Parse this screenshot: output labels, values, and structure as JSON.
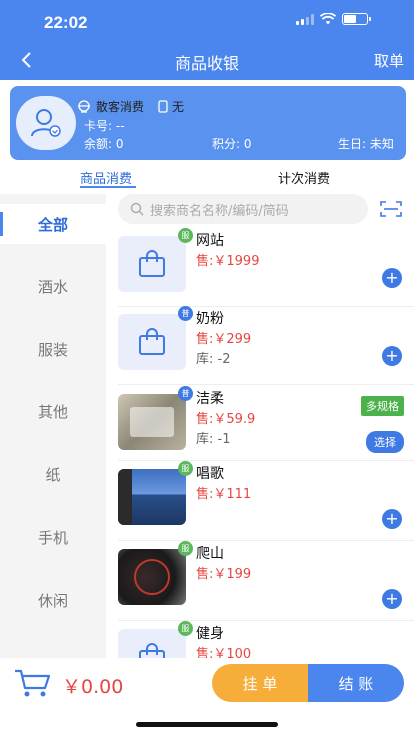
{
  "status_bar": {
    "time": "22:02"
  },
  "header": {
    "title": "商品收银",
    "cancel_label": "取单"
  },
  "member": {
    "name": "散客消费",
    "card_status": "无",
    "card_no_label": "卡号: --",
    "balance_label": "余额: 0",
    "points_label": "积分: 0",
    "birthday_label": "生日: 未知"
  },
  "tabs": [
    {
      "label": "商品消费",
      "active": true
    },
    {
      "label": "计次消费",
      "active": false
    }
  ],
  "categories": [
    {
      "label": "全部",
      "active": true
    },
    {
      "label": "酒水"
    },
    {
      "label": "服装"
    },
    {
      "label": "其他"
    },
    {
      "label": "纸"
    },
    {
      "label": "手机"
    },
    {
      "label": "休闲"
    }
  ],
  "search": {
    "placeholder": "搜索商名名称/编码/简码"
  },
  "products": [
    {
      "badge": "服",
      "badge_color": "#5cb85c",
      "name": "网站",
      "price": "售:￥1999",
      "stock": "",
      "image": "bag-icon"
    },
    {
      "badge": "普",
      "badge_color": "#3f79e4",
      "name": "奶粉",
      "price": "售:￥299",
      "stock": "库: -2",
      "image": "bag-icon"
    },
    {
      "badge": "普",
      "badge_color": "#3f79e4",
      "name": "洁柔",
      "price": "售:￥59.9",
      "stock": "库: -1",
      "image": "photo",
      "tag": "多规格",
      "action": "选择"
    },
    {
      "badge": "服",
      "badge_color": "#5cb85c",
      "name": "唱歌",
      "price": "售:￥111",
      "stock": "",
      "image": "photo"
    },
    {
      "badge": "服",
      "badge_color": "#5cb85c",
      "name": "爬山",
      "price": "售:￥199",
      "stock": "",
      "image": "photo"
    },
    {
      "badge": "服",
      "badge_color": "#5cb85c",
      "name": "健身",
      "price": "售:￥100",
      "stock": "",
      "image": "bag-icon"
    }
  ],
  "footer": {
    "total": "￥0.00",
    "hold_label": "挂 单",
    "checkout_label": "结 账"
  },
  "colors": {
    "primary": "#4a86ee",
    "price": "#e5473f",
    "hold": "#f6ad3a",
    "tag": "#4cb24c"
  }
}
